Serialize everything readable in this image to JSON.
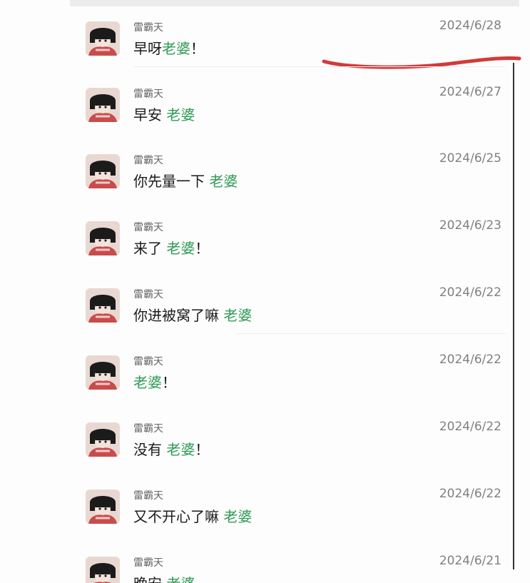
{
  "chat": {
    "items": [
      {
        "sender": "雷霸天",
        "date": "2024/6/28",
        "text_before": "早呀",
        "highlight": "老婆",
        "text_after": "！"
      },
      {
        "sender": "雷霸天",
        "date": "2024/6/27",
        "text_before": "早安 ",
        "highlight": "老婆",
        "text_after": ""
      },
      {
        "sender": "雷霸天",
        "date": "2024/6/25",
        "text_before": "你先量一下 ",
        "highlight": "老婆",
        "text_after": ""
      },
      {
        "sender": "雷霸天",
        "date": "2024/6/23",
        "text_before": "来了 ",
        "highlight": "老婆",
        "text_after": "！"
      },
      {
        "sender": "雷霸天",
        "date": "2024/6/22",
        "text_before": "你进被窝了嘛 ",
        "highlight": "老婆",
        "text_after": ""
      },
      {
        "sender": "雷霸天",
        "date": "2024/6/22",
        "text_before": "",
        "highlight": "老婆",
        "text_after": "！"
      },
      {
        "sender": "雷霸天",
        "date": "2024/6/22",
        "text_before": "没有 ",
        "highlight": "老婆",
        "text_after": "！"
      },
      {
        "sender": "雷霸天",
        "date": "2024/6/22",
        "text_before": "又不开心了嘛 ",
        "highlight": "老婆",
        "text_after": ""
      },
      {
        "sender": "雷霸天",
        "date": "2024/6/21",
        "text_before": "晚安 ",
        "highlight": "老婆",
        "text_after": ""
      }
    ]
  },
  "colors": {
    "highlight": "#2e9a55",
    "annotation": "#d23a3a",
    "sender": "#666666",
    "date": "#808080"
  },
  "icons": {
    "avatar": "avatar-icon",
    "annotation": "red-underline-annotation"
  }
}
